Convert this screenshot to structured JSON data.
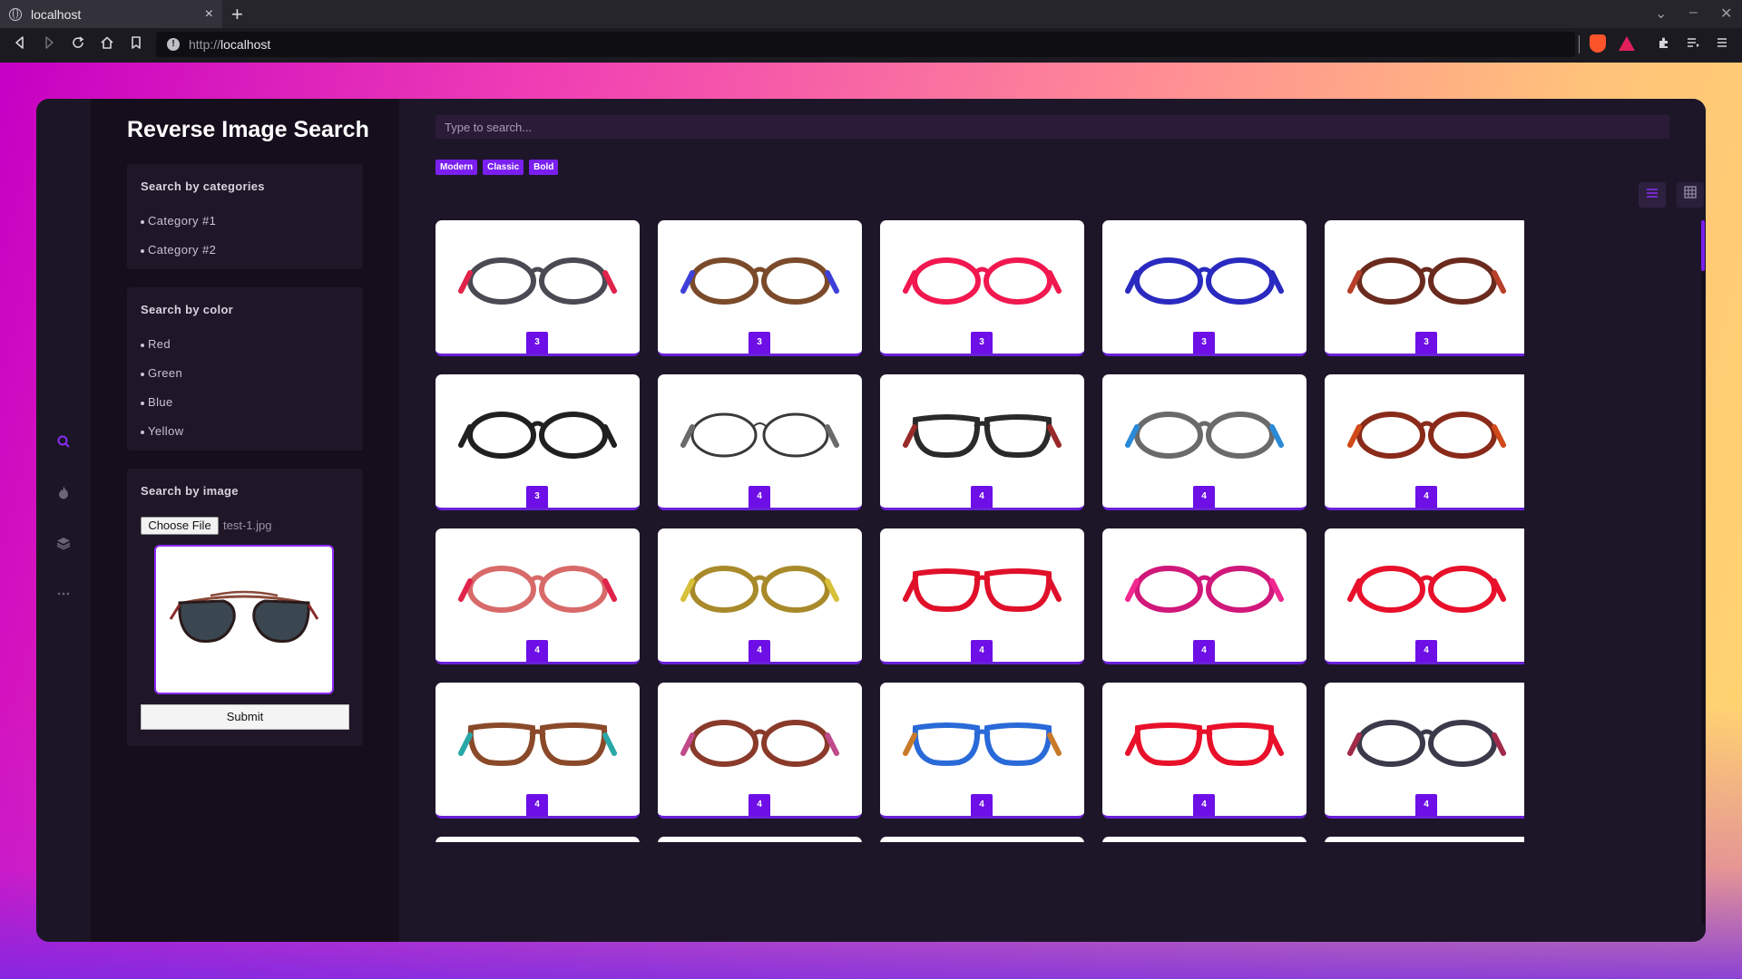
{
  "browser": {
    "tab_title": "localhost",
    "tab_close": "×",
    "new_tab": "+",
    "url_scheme": "http://",
    "url_host": "localhost"
  },
  "app": {
    "title": "Reverse Image Search"
  },
  "categories": {
    "title": "Search by categories",
    "items": [
      "Category #1",
      "Category #2"
    ]
  },
  "colors_filter": {
    "title": "Search by color",
    "items": [
      "Red",
      "Green",
      "Blue",
      "Yellow"
    ]
  },
  "image_search": {
    "title": "Search by image",
    "choose_file_label": "Choose File",
    "file_name": "test-1.jpg",
    "submit_label": "Submit"
  },
  "search": {
    "placeholder": "Type to search..."
  },
  "tags": [
    "Modern",
    "Classic",
    "Bold"
  ],
  "accent_color": "#7a1ff0",
  "results": [
    {
      "badge": "3",
      "frame_color": "#4a4a55",
      "accent": "#e0234a",
      "shape": "round"
    },
    {
      "badge": "3",
      "frame_color": "#7a4a2a",
      "accent": "#3d3fd8",
      "shape": "round"
    },
    {
      "badge": "3",
      "frame_color": "#f0184f",
      "accent": "#f0184f",
      "shape": "round"
    },
    {
      "badge": "3",
      "frame_color": "#2a2ac0",
      "accent": "#2a2ac0",
      "shape": "round"
    },
    {
      "badge": "3",
      "frame_color": "#6a2a1e",
      "accent": "#b8402a",
      "shape": "round"
    },
    {
      "badge": "3",
      "frame_color": "#202020",
      "accent": "#202020",
      "shape": "round"
    },
    {
      "badge": "4",
      "frame_color": "#3a3a3a",
      "accent": "#6a6a6a",
      "shape": "thin"
    },
    {
      "badge": "4",
      "frame_color": "#2a2a2a",
      "accent": "#9a2a2a",
      "shape": "square"
    },
    {
      "badge": "4",
      "frame_color": "#6a6a6a",
      "accent": "#2a8ad8",
      "shape": "round"
    },
    {
      "badge": "4",
      "frame_color": "#8a2a1a",
      "accent": "#d04a1a",
      "shape": "round"
    },
    {
      "badge": "4",
      "frame_color": "#d86a6a",
      "accent": "#e0234a",
      "shape": "round"
    },
    {
      "badge": "4",
      "frame_color": "#a88a2a",
      "accent": "#d8c03a",
      "shape": "round"
    },
    {
      "badge": "4",
      "frame_color": "#e0102a",
      "accent": "#e0102a",
      "shape": "square"
    },
    {
      "badge": "4",
      "frame_color": "#d0187a",
      "accent": "#f02890",
      "shape": "round"
    },
    {
      "badge": "4",
      "frame_color": "#e8102a",
      "accent": "#e8102a",
      "shape": "round"
    },
    {
      "badge": "4",
      "frame_color": "#8a4a2a",
      "accent": "#2aa8a8",
      "shape": "square"
    },
    {
      "badge": "4",
      "frame_color": "#8a3a2a",
      "accent": "#c04a8a",
      "shape": "round"
    },
    {
      "badge": "4",
      "frame_color": "#2a6ad8",
      "accent": "#c87a2a",
      "shape": "square"
    },
    {
      "badge": "4",
      "frame_color": "#e8102a",
      "accent": "#e8102a",
      "shape": "square"
    },
    {
      "badge": "4",
      "frame_color": "#3a3a4a",
      "accent": "#a02a4a",
      "shape": "round"
    },
    {
      "badge": "",
      "frame_color": "#7a1020",
      "accent": "#c0204a",
      "shape": "round"
    },
    {
      "badge": "",
      "frame_color": "#3a2a2a",
      "accent": "#2a2a3a",
      "shape": "round"
    },
    {
      "badge": "",
      "frame_color": "#9a5a5a",
      "accent": "#c08a8a",
      "shape": "round"
    },
    {
      "badge": "",
      "frame_color": "#6a5a4a",
      "accent": "#b86a2a",
      "shape": "thin"
    },
    {
      "badge": "",
      "frame_color": "#4a4a4a",
      "accent": "#2a2a2a",
      "shape": "thin"
    }
  ]
}
